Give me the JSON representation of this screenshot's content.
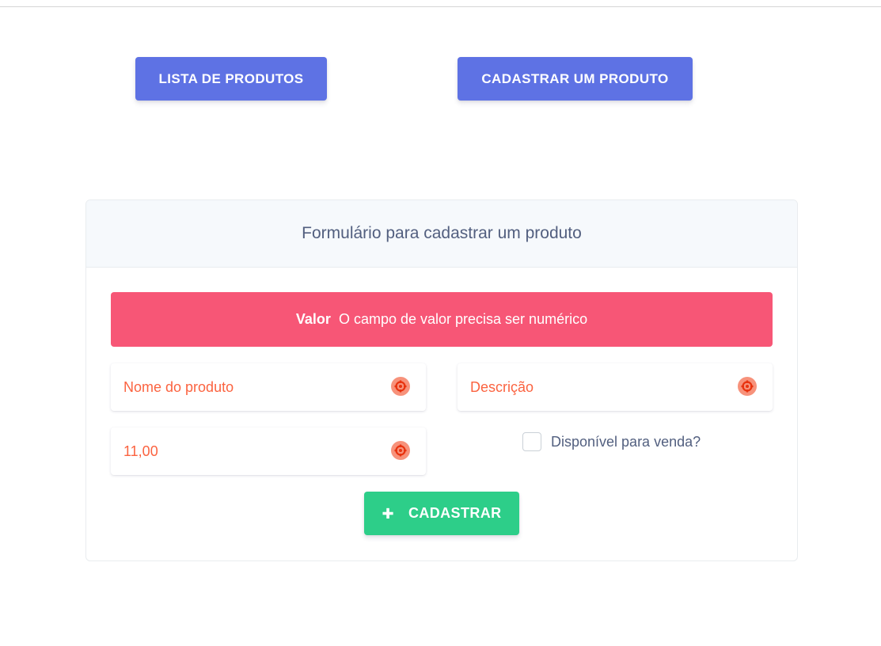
{
  "nav": {
    "list_label": "LISTA DE PRODUTOS",
    "register_label": "CADASTRAR UM PRODUTO",
    "accent": "#5e72e4"
  },
  "card": {
    "title": "Formulário para cadastrar um produto"
  },
  "alert": {
    "field": "Valor",
    "message": "O campo de valor precisa ser numérico",
    "color": "#f75676"
  },
  "form": {
    "name": {
      "placeholder": "Nome do produto",
      "value": "",
      "icon": "error-icon"
    },
    "description": {
      "placeholder": "Descrição",
      "value": "",
      "icon": "error-icon"
    },
    "price": {
      "placeholder": "",
      "value": "11,00",
      "icon": "error-icon"
    },
    "available": {
      "label": "Disponível para venda?",
      "checked": false
    },
    "error_color": "#fb6340"
  },
  "submit": {
    "label": "CADASTRAR",
    "icon": "plus-icon",
    "color": "#2dce89"
  }
}
